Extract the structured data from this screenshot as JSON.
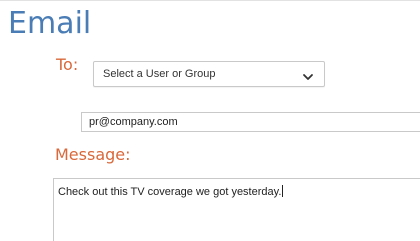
{
  "form": {
    "title": "Email",
    "to_label": "To:",
    "recipient_select": {
      "selected": "Select a User or Group",
      "icon": "chevron-down-icon"
    },
    "email_value": "pr@company.com",
    "message_label": "Message:",
    "message_value": "Check out this TV coverage we got yesterday."
  },
  "colors": {
    "title": "#4a7db5",
    "label": "#d9683a",
    "border": "#c9c9c9"
  }
}
